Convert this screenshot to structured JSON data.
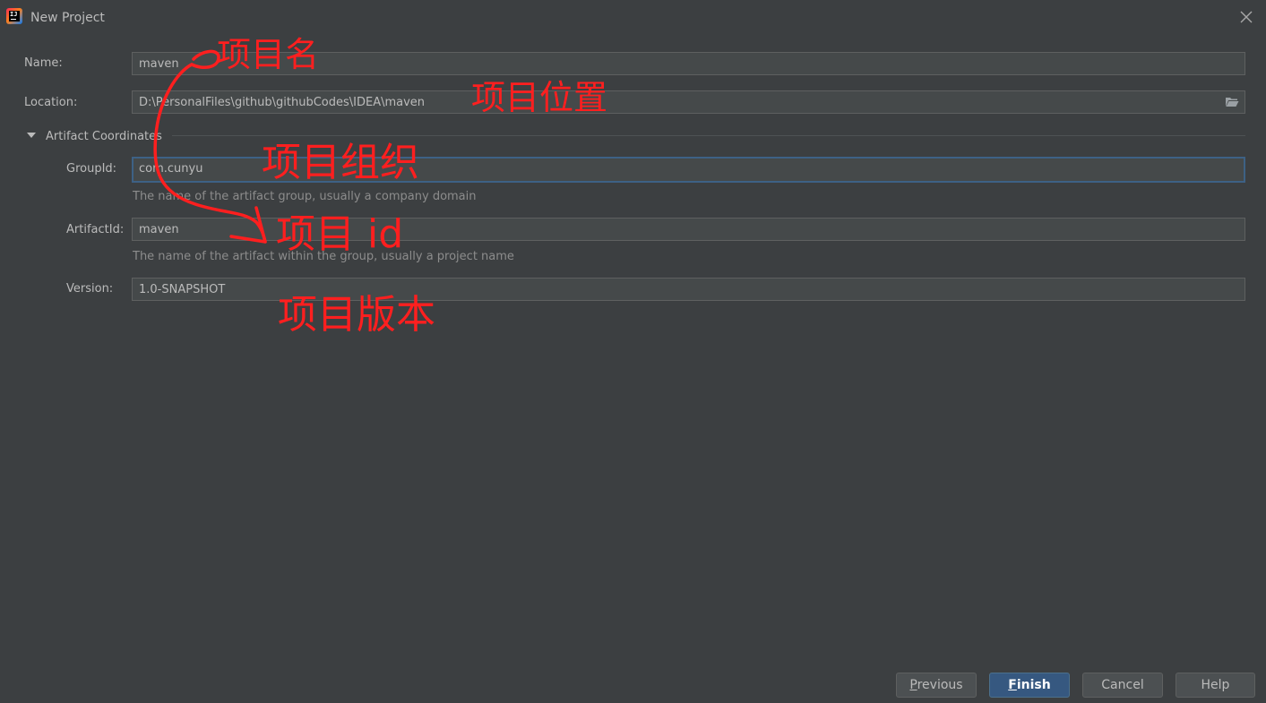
{
  "window": {
    "title": "New Project",
    "app_icon": "intellij-idea-icon",
    "close_icon": "close-icon"
  },
  "form": {
    "name": {
      "label": "Name:",
      "value": "maven"
    },
    "location": {
      "label": "Location:",
      "value": "D:\\PersonalFiles\\github\\githubCodes\\IDEA\\maven",
      "browse_icon": "folder-icon"
    },
    "section": {
      "title": "Artifact Coordinates",
      "expanded": true
    },
    "group_id": {
      "label": "GroupId:",
      "value": "com.cunyu",
      "hint": "The name of the artifact group, usually a company domain"
    },
    "artifact_id": {
      "label": "ArtifactId:",
      "value": "maven",
      "hint": "The name of the artifact within the group, usually a project name"
    },
    "version": {
      "label": "Version:",
      "value": "1.0-SNAPSHOT"
    }
  },
  "buttons": {
    "previous": {
      "mnemonic": "P",
      "rest": "revious"
    },
    "finish": {
      "mnemonic": "F",
      "rest": "inish"
    },
    "cancel": "Cancel",
    "help": "Help"
  },
  "annotations": {
    "color": "#ff1f1f",
    "project_name": "项目名",
    "project_location": "项目位置",
    "project_group": "项目组织",
    "project_id": "项目 id",
    "project_version": "项目版本"
  },
  "colors": {
    "background": "#3c3f41",
    "field_bg": "#45494a",
    "focus_border": "#3d6185",
    "primary_button": "#365880"
  }
}
